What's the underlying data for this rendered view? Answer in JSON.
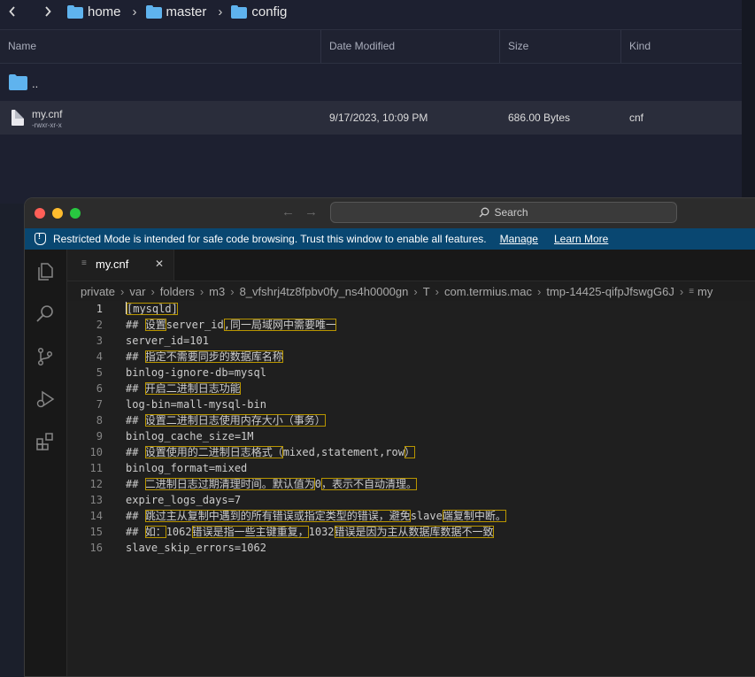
{
  "browser": {
    "breadcrumb": [
      "home",
      "master",
      "config"
    ],
    "columns": {
      "name": "Name",
      "date": "Date Modified",
      "size": "Size",
      "kind": "Kind"
    },
    "rows": [
      {
        "name": "..",
        "meta": "",
        "date": "",
        "size": "",
        "kind": ""
      },
      {
        "name": "my.cnf",
        "meta": "-rwxr-xr-x",
        "date": "9/17/2023, 10:09 PM",
        "size": "686.00 Bytes",
        "kind": "cnf"
      }
    ]
  },
  "editor_window": {
    "search_label": "Search",
    "banner": {
      "text": "Restricted Mode is intended for safe code browsing. Trust this window to enable all features.",
      "manage": "Manage",
      "learn_more": "Learn More"
    },
    "tab": {
      "title": "my.cnf",
      "close": "✕"
    },
    "breadcrumbs": [
      "private",
      "var",
      "folders",
      "m3",
      "8_vfshrj4tz8fpbv0fy_ns4h0000gn",
      "T",
      "com.termius.mac",
      "tmp-14425-qifpJfswgG6J",
      "my"
    ],
    "lines": [
      {
        "n": "1",
        "segs": [
          {
            "t": "[mysqld]",
            "hl": true
          }
        ]
      },
      {
        "n": "2",
        "segs": [
          {
            "t": "## "
          },
          {
            "t": "设置",
            "hl": true
          },
          {
            "t": "server_id"
          },
          {
            "t": ",同一局域网中需要唯一",
            "hl": true
          }
        ]
      },
      {
        "n": "3",
        "segs": [
          {
            "t": "server_id=101"
          }
        ]
      },
      {
        "n": "4",
        "segs": [
          {
            "t": "## "
          },
          {
            "t": "指定不需要同步的数据库名称",
            "hl": true
          }
        ]
      },
      {
        "n": "5",
        "segs": [
          {
            "t": "binlog-ignore-db=mysql"
          }
        ]
      },
      {
        "n": "6",
        "segs": [
          {
            "t": "## "
          },
          {
            "t": "开启二进制日志功能",
            "hl": true
          }
        ]
      },
      {
        "n": "7",
        "segs": [
          {
            "t": "log-bin=mall-mysql-bin"
          }
        ]
      },
      {
        "n": "8",
        "segs": [
          {
            "t": "## "
          },
          {
            "t": "设置二进制日志使用内存大小（事务）",
            "hl": true
          }
        ]
      },
      {
        "n": "9",
        "segs": [
          {
            "t": "binlog_cache_size=1M"
          }
        ]
      },
      {
        "n": "10",
        "segs": [
          {
            "t": "## "
          },
          {
            "t": "设置使用的二进制日志格式（",
            "hl": true
          },
          {
            "t": "mixed,statement,row"
          },
          {
            "t": "）",
            "hl": true
          }
        ]
      },
      {
        "n": "11",
        "segs": [
          {
            "t": "binlog_format=mixed"
          }
        ]
      },
      {
        "n": "12",
        "segs": [
          {
            "t": "## "
          },
          {
            "t": "二进制日志过期清理时间。默认值为",
            "hl": true
          },
          {
            "t": "0"
          },
          {
            "t": "，表示不自动清理。",
            "hl": true
          }
        ]
      },
      {
        "n": "13",
        "segs": [
          {
            "t": "expire_logs_days=7"
          }
        ]
      },
      {
        "n": "14",
        "segs": [
          {
            "t": "## "
          },
          {
            "t": "跳过主从复制中遇到的所有错误或指定类型的错误，避免",
            "hl": true
          },
          {
            "t": "slave"
          },
          {
            "t": "端复制中断。",
            "hl": true
          }
        ]
      },
      {
        "n": "15",
        "segs": [
          {
            "t": "## "
          },
          {
            "t": "如：",
            "hl": true
          },
          {
            "t": "1062"
          },
          {
            "t": "错误是指一些主键重复，",
            "hl": true
          },
          {
            "t": "1032"
          },
          {
            "t": "错误是因为主从数据库数据不一致",
            "hl": true
          }
        ]
      },
      {
        "n": "16",
        "segs": [
          {
            "t": "slave_skip_errors=1062"
          }
        ]
      }
    ]
  }
}
